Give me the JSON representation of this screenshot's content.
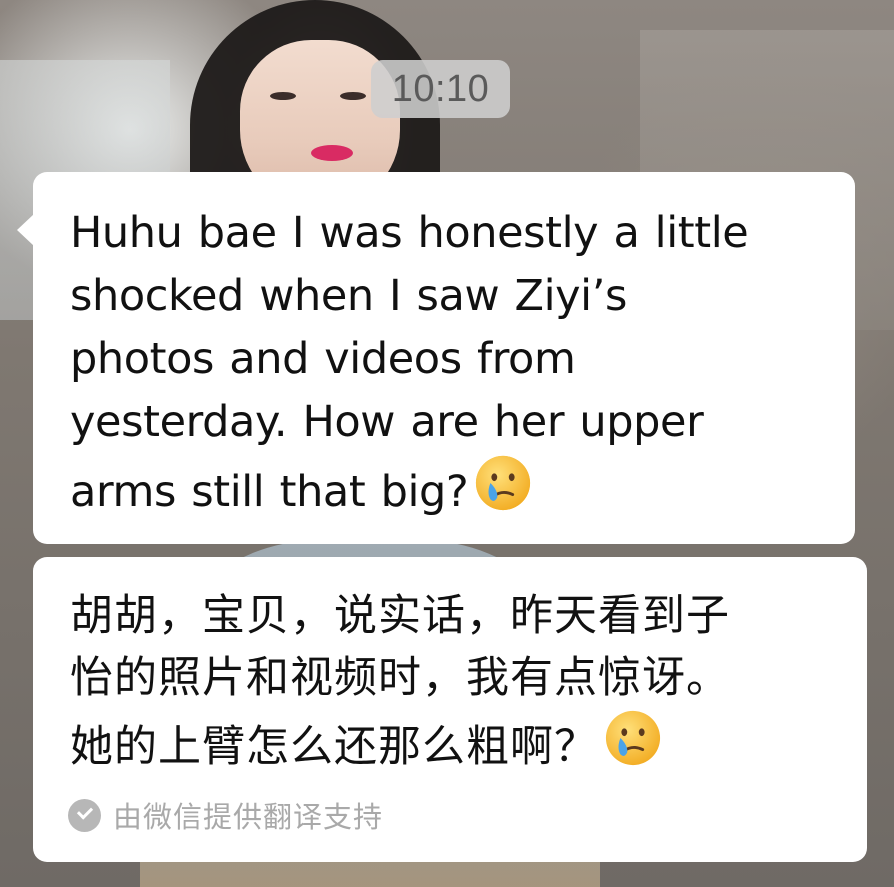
{
  "background": {
    "description_icon": "photo-background"
  },
  "time": "10:10",
  "message": {
    "lines": [
      "Huhu bae I was honestly a little",
      "shocked when I saw Ziyi’s",
      "photos and videos from",
      "yesterday. How are her upper",
      "arms still that big?"
    ],
    "emoji_icon": "sad-tear-face-icon"
  },
  "translation": {
    "lines": [
      "胡胡，宝贝，说实话，昨天看到子",
      "怡的照片和视频时，我有点惊讶。",
      "她的上臂怎么还那么粗啊？"
    ],
    "emoji_icon": "sad-tear-face-icon",
    "footer_label": "由微信提供翻译支持",
    "footer_icon": "check-circle-icon"
  },
  "colors": {
    "bubble": "#ffffff",
    "text": "#111111",
    "footer_text": "#a9a9a9",
    "time_pill": "#cecece"
  }
}
